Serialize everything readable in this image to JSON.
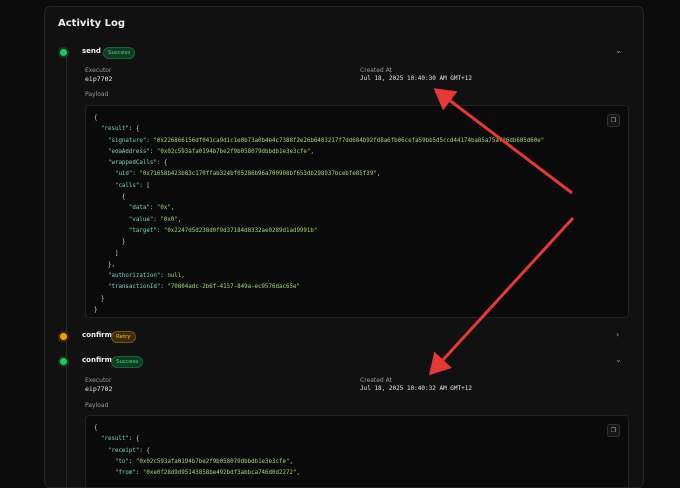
{
  "title": "Activity Log",
  "events": [
    {
      "name": "send",
      "status": "Success",
      "executor_label": "Executor",
      "executor": "eip7702",
      "created_label": "Created At",
      "created_at": "Jul 18, 2025 10:40:30 AM GMT+12",
      "payload_label": "Payload"
    },
    {
      "name": "confirm",
      "status": "Retry"
    },
    {
      "name": "confirm",
      "status": "Success",
      "executor_label": "Executor",
      "executor": "eip7702",
      "created_label": "Created At",
      "created_at": "Jul 18, 2025 10:40:32 AM GMT+12",
      "payload_label": "Payload"
    }
  ],
  "payload1": {
    "signature": "0x226866156df041ca9d1c1e0b73a0b4e4c7388f2e26b6403217f7dd684b92fd8a6fb06cefa59bb5d5ccd44174ba85a75af26db605d60e",
    "eoaAddress": "0x02c593afa0194b7be2f9b058079dbbdb1e3e3cfe",
    "uid": "0x71658b423b83c170ffab324bf05286b96a700908bf653db298937bcebfe85f39",
    "data": "0x",
    "value": "0x0",
    "target": "0x2247d5d238d0f9d37184d8332ae0289d1ad9991b",
    "authorization": "null",
    "transactionId": "70804adc-2b6f-4157-849a-ec9576dac65e"
  },
  "payload2": {
    "to": "0x02c593afa0194b7be2f9b058079dbbdb1e3e3cfe",
    "from": "0xe0f28d9d95143858be492bdf3abbca746d0d2272"
  },
  "colors": {
    "accent_success": "#22c55e",
    "accent_retry": "#f59e0b",
    "arrow": "#e53935"
  }
}
